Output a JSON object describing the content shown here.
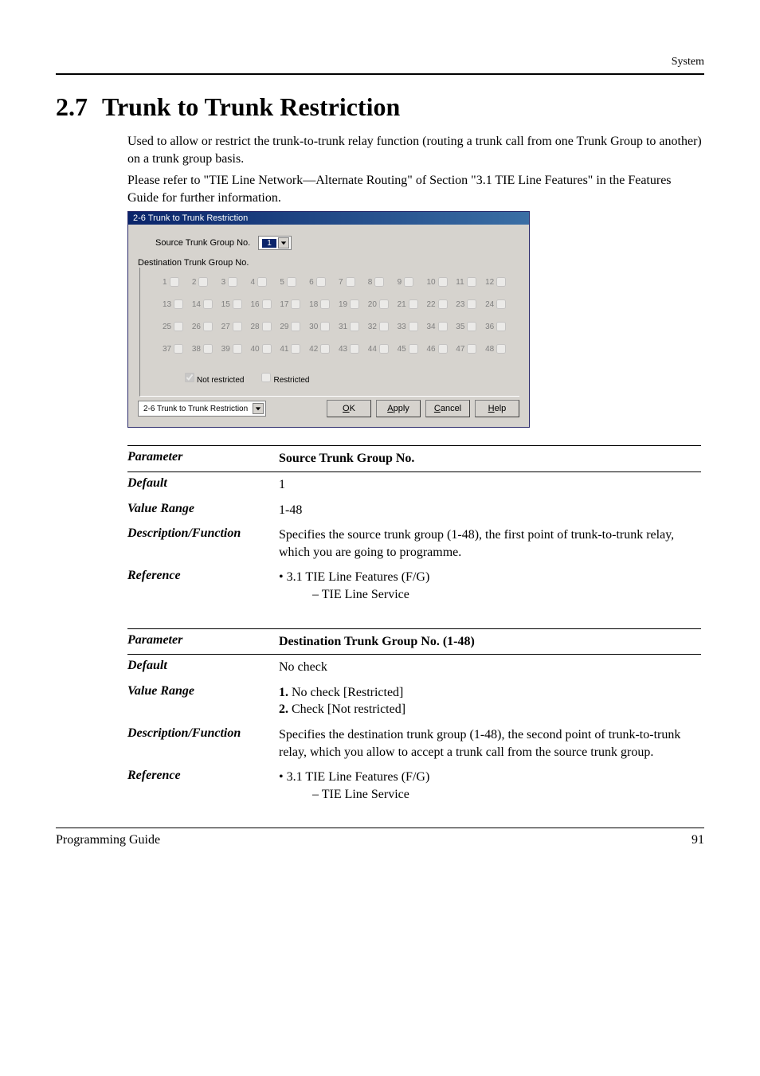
{
  "header": {
    "category": "System"
  },
  "section": {
    "number": "2.7",
    "title": "Trunk to Trunk Restriction"
  },
  "intro": [
    "Used to allow or restrict the trunk-to-trunk relay function (routing a trunk call from one Trunk Group to another) on a trunk group basis.",
    "Please refer to \"TIE Line Network—Alternate Routing\" of Section \"3.1 TIE Line Features\" in the Features Guide for further information."
  ],
  "window": {
    "title": "2-6 Trunk to Trunk Restriction",
    "source_label": "Source Trunk Group No.",
    "source_value": "1",
    "group_label": "Destination Trunk Group No.",
    "legend_not_restricted": "Not restricted",
    "legend_restricted": "Restricted",
    "nav_value": "2-6 Trunk to Trunk Restriction",
    "btn_ok": "OK",
    "btn_apply": "Apply",
    "btn_cancel": "Cancel",
    "btn_help": "Help",
    "checkbox_numbers": [
      [
        1,
        2,
        3,
        4,
        5,
        6,
        7,
        8,
        9,
        10,
        11,
        12
      ],
      [
        13,
        14,
        15,
        16,
        17,
        18,
        19,
        20,
        21,
        22,
        23,
        24
      ],
      [
        25,
        26,
        27,
        28,
        29,
        30,
        31,
        32,
        33,
        34,
        35,
        36
      ],
      [
        37,
        38,
        39,
        40,
        41,
        42,
        43,
        44,
        45,
        46,
        47,
        48
      ]
    ]
  },
  "tables": [
    {
      "header_label": "Parameter",
      "header_value": "Source Trunk Group No.",
      "rows": [
        {
          "label": "Default",
          "value": "1"
        },
        {
          "label": "Value Range",
          "value": "1-48"
        },
        {
          "label": "Description/Function",
          "value": "Specifies the source trunk group (1-48), the first point of trunk-to-trunk relay, which you are going to programme."
        },
        {
          "label": "Reference",
          "bullet": "• 3.1 TIE Line Features (F/G)",
          "sub": "– TIE Line Service"
        }
      ]
    },
    {
      "header_label": "Parameter",
      "header_value": "Destination Trunk Group No. (1-48)",
      "rows": [
        {
          "label": "Default",
          "value": "No check"
        },
        {
          "label": "Value Range",
          "list": [
            {
              "n": "1.",
              "t": "No check [Restricted]"
            },
            {
              "n": "2.",
              "t": "Check [Not restricted]"
            }
          ]
        },
        {
          "label": "Description/Function",
          "value": "Specifies the destination trunk group (1-48), the second point of trunk-to-trunk relay, which you allow to accept a trunk call from the source trunk group."
        },
        {
          "label": "Reference",
          "bullet": "• 3.1 TIE Line Features (F/G)",
          "sub": "– TIE Line Service"
        }
      ]
    }
  ],
  "footer": {
    "left": "Programming Guide",
    "right": "91"
  }
}
